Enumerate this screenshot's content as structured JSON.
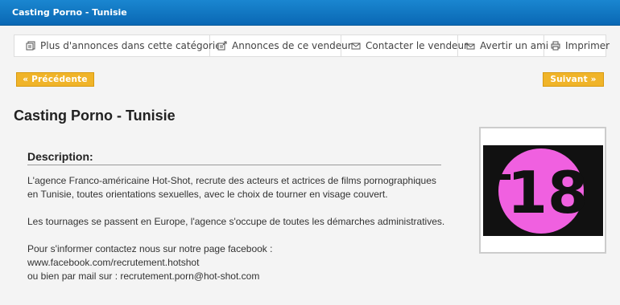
{
  "header": {
    "title": "Casting Porno - Tunisie"
  },
  "toolbar": {
    "more_ads": "Plus d'annonces dans cette catégorie",
    "seller_ads": "Annonces de ce vendeur",
    "contact": "Contacter le vendeur",
    "notify": "Avertir un ami",
    "print": "Imprimer"
  },
  "nav": {
    "prev": "« Précédente",
    "next": "Suivant »"
  },
  "ad": {
    "title": "Casting Porno - Tunisie",
    "description_label": "Description:",
    "paragraph1": "L'agence Franco-américaine Hot-Shot, recrute des acteurs et actrices de films pornographiques en Tunisie, toutes orientations sexuelles, avec le choix de tourner en visage couvert.",
    "paragraph2": "Les tournages se passent en Europe, l'agence s'occupe de toutes les démarches administratives.",
    "contact_line1": "Pour s'informer contactez nous sur notre page facebook :",
    "contact_line2": "www.facebook.com/recrutement.hotshot",
    "contact_line3": "ou bien par mail sur : recrutement.porn@hot-shot.com"
  },
  "image": {
    "text": "18",
    "circle_color": "#f060e0",
    "bg_color": "#111111"
  }
}
